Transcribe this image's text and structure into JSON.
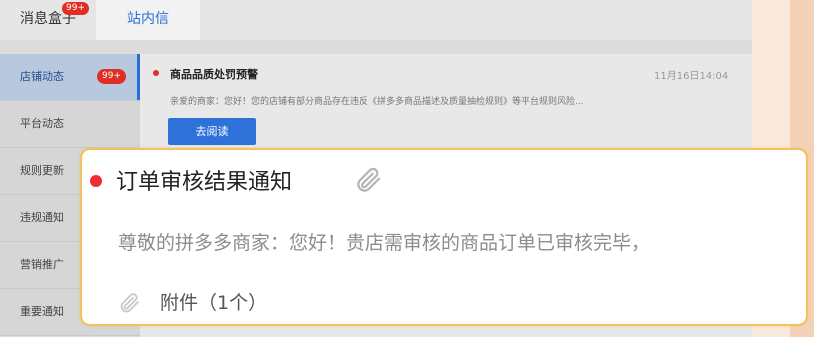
{
  "tabs": {
    "message_box": "消息盒子",
    "message_box_badge": "99+",
    "site_mail": "站内信"
  },
  "sidebar": {
    "items": [
      {
        "label": "店铺动态",
        "badge": "99+"
      },
      {
        "label": "平台动态"
      },
      {
        "label": "规则更新"
      },
      {
        "label": "违规通知"
      },
      {
        "label": "营销推广"
      },
      {
        "label": "重要通知"
      }
    ]
  },
  "message": {
    "title": "商品品质处罚预警",
    "time": "11月16日14:04",
    "body": "亲爱的商家：您好！您的店铺有部分商品存在违反《拼多多商品描述及质量抽检规则》等平台规则风险...",
    "read_button": "去阅读"
  },
  "card": {
    "title": "订单审核结果通知",
    "body": "尊敬的拼多多商家：您好！贵店需审核的商品订单已审核完毕，",
    "attachment": "附件（1个）"
  },
  "colors": {
    "accent": "#2e71d8",
    "badge": "#e02e24",
    "card_border": "#f2c163"
  }
}
